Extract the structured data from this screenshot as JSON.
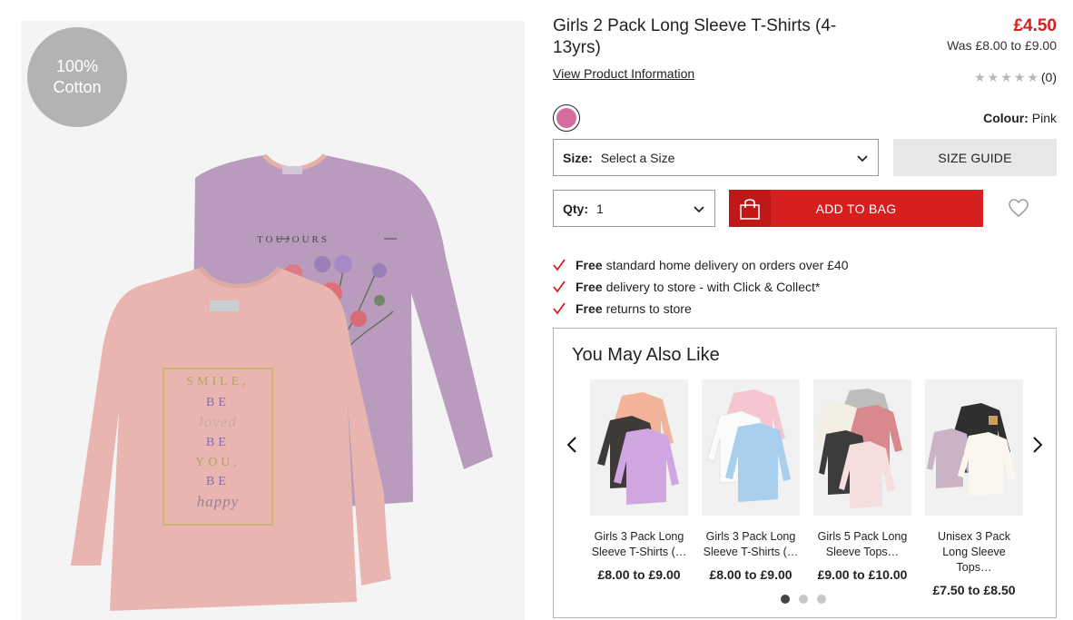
{
  "product": {
    "badge_line1": "100%",
    "badge_line2": "Cotton",
    "title": "Girls 2 Pack Long Sleeve T-Shirts (4-13yrs)",
    "price": "£4.50",
    "was_price": "Was £8.00 to £9.00",
    "view_info": "View Product Information",
    "rating_count": "(0)",
    "rating_value": 0,
    "colour_label": "Colour:",
    "colour_value": "Pink",
    "swatch_color": "#d56e9e",
    "print_front": [
      "SMILE,",
      "BE",
      "loved",
      "BE",
      "YOU,",
      "BE",
      "happy"
    ],
    "print_back": "TOUJOURS"
  },
  "options": {
    "size_label": "Size:",
    "size_value": "Select a Size",
    "size_guide": "SIZE GUIDE",
    "qty_label": "Qty:",
    "qty_value": "1",
    "add_to_bag": "ADD TO BAG"
  },
  "benefits": [
    {
      "bold": "Free",
      "text": "standard home delivery on orders over £40"
    },
    {
      "bold": "Free",
      "text": "delivery to store - with Click & Collect*"
    },
    {
      "bold": "Free",
      "text": "returns to store"
    }
  ],
  "recommendations": {
    "title": "You May Also Like",
    "items": [
      {
        "name": "Girls 3 Pack Long Sleeve T-Shirts (…",
        "price": "£8.00 to £9.00"
      },
      {
        "name": "Girls 3 Pack Long Sleeve T-Shirts (…",
        "price": "£8.00 to £9.00"
      },
      {
        "name": "Girls 5 Pack Long Sleeve Tops…",
        "price": "£9.00 to £10.00"
      },
      {
        "name": "Unisex 3 Pack Long Sleeve Tops…",
        "price": "£7.50 to £8.50"
      }
    ],
    "pagination_pages": 3,
    "pagination_active": 1
  },
  "colors": {
    "accent_red": "#d62020",
    "shirt_pink": "#e9b5b0",
    "shirt_purple": "#b89bbd"
  }
}
